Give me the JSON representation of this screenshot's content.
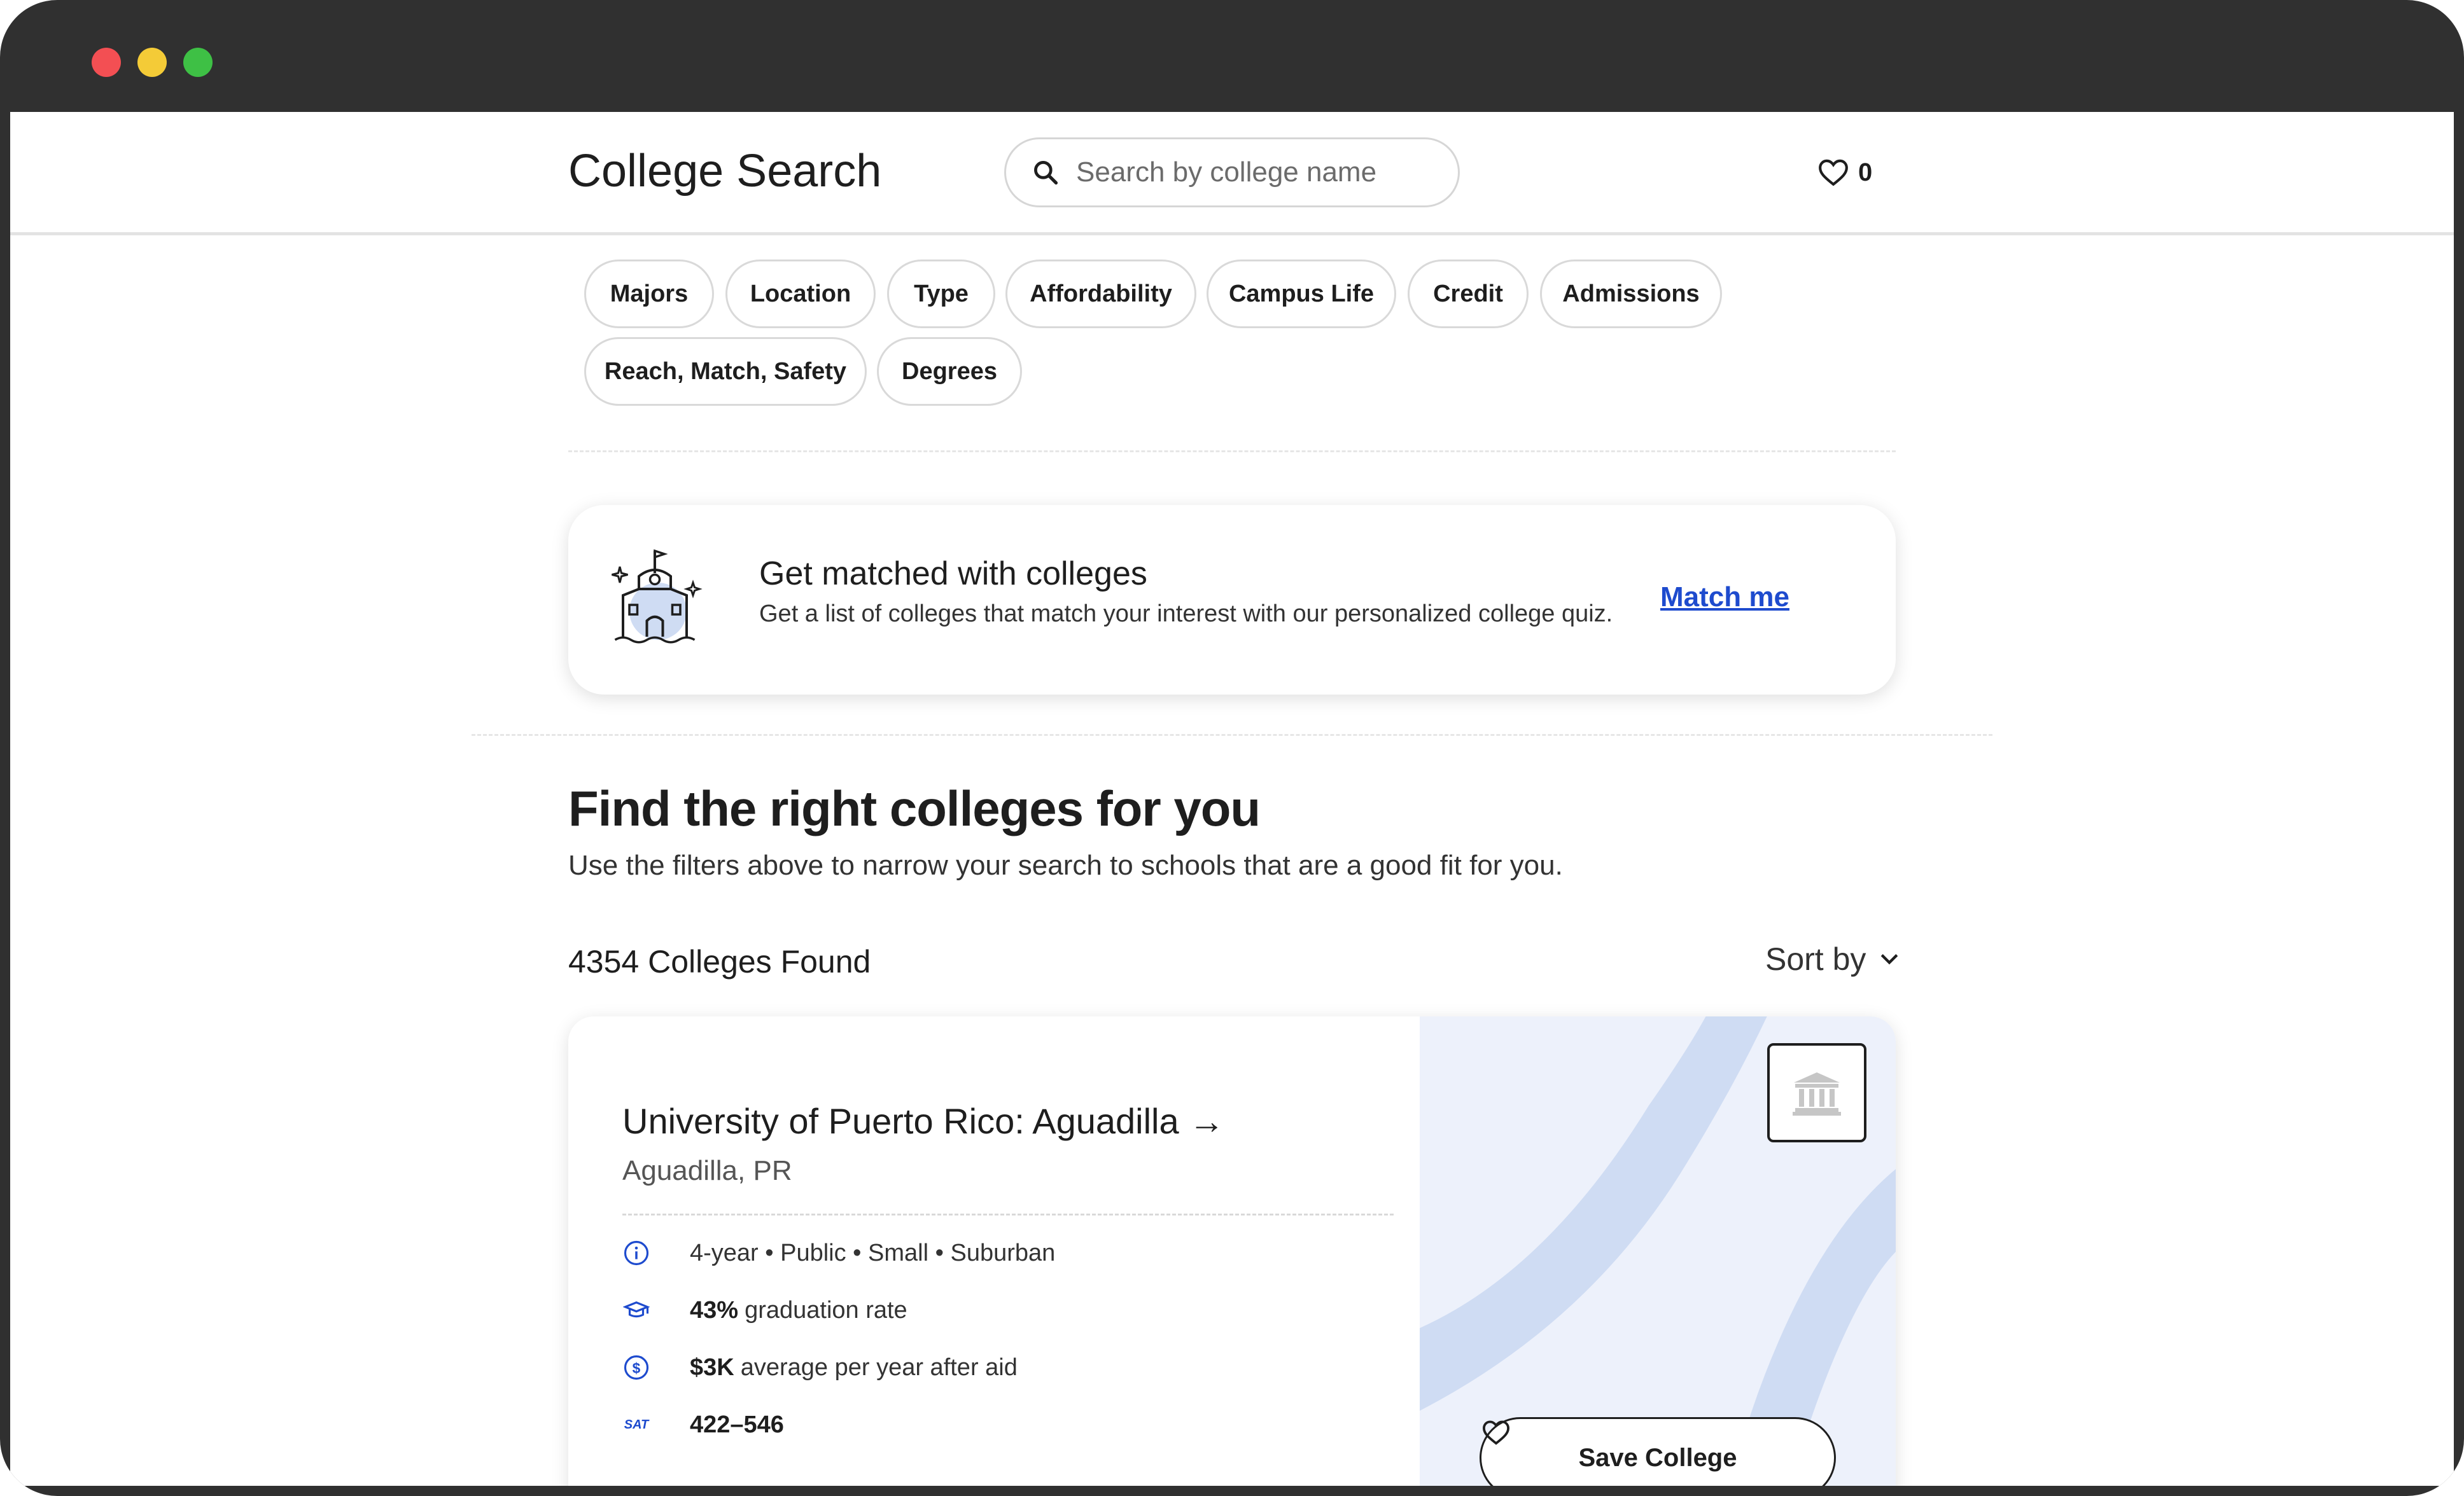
{
  "header": {
    "title": "College Search",
    "search_placeholder": "Search by college name",
    "favorites_count": "0"
  },
  "filters": [
    "Majors",
    "Location",
    "Type",
    "Affordability",
    "Campus Life",
    "Credit",
    "Admissions",
    "Reach, Match, Safety",
    "Degrees"
  ],
  "match_card": {
    "title": "Get matched with colleges",
    "subtitle": "Get a list of colleges that match your interest with our personalized college quiz.",
    "link": "Match me"
  },
  "results": {
    "heading": "Find the right colleges for you",
    "subheading": "Use the filters above to narrow your search to schools that are a good fit for you.",
    "count_label": "4354 Colleges Found",
    "sort_label": "Sort by"
  },
  "college": {
    "name": "University of Puerto Rico: Aguadilla →",
    "location": "Aguadilla, PR",
    "type_line": "4-year • Public • Small • Suburban",
    "graduation_value": "43%",
    "graduation_label": "graduation rate",
    "cost_value": "$3K",
    "cost_label": "average per year after aid",
    "sat_badge": "SAT",
    "sat_range": "422–546",
    "save_label": "Save College"
  },
  "icons": {
    "search": "search-icon",
    "favorites": "heart-icon",
    "school": "school-building-icon",
    "info": "info-icon",
    "graduation": "graduation-cap-icon",
    "cost": "dollar-icon",
    "logo": "institution-icon"
  },
  "colors": {
    "accent": "#1e4bce",
    "text": "#1e1e1e",
    "map_bg": "#edf1fb",
    "map_stripe": "#cfdcf3"
  }
}
